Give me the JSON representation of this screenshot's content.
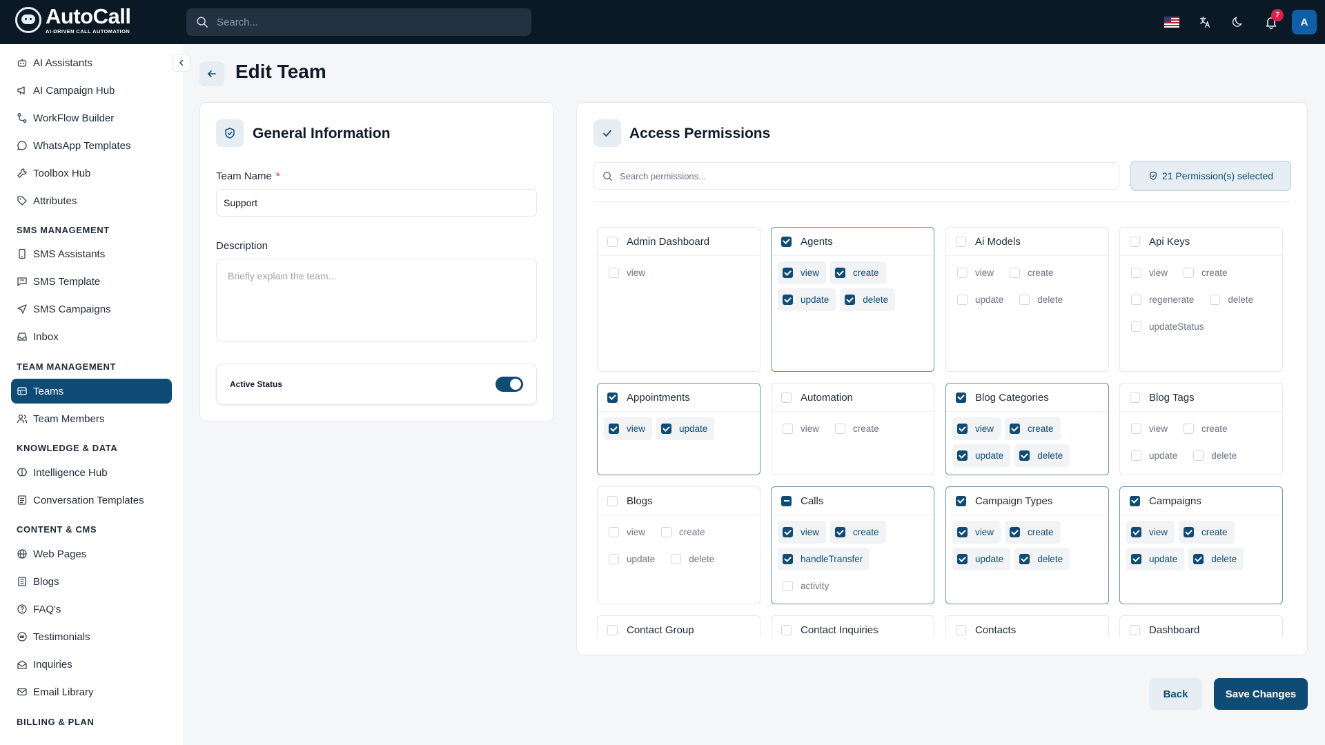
{
  "brand": {
    "name": "AutoCall",
    "tagline": "AI-DRIVEN CALL AUTOMATION"
  },
  "topbar": {
    "search_placeholder": "Search...",
    "notification_count": "7",
    "avatar_initial": "A"
  },
  "sidebar": {
    "items_top": [
      {
        "label": "AI Assistants",
        "icon": "robot-icon"
      },
      {
        "label": "AI Campaign Hub",
        "icon": "megaphone-icon"
      },
      {
        "label": "WorkFlow Builder",
        "icon": "workflow-icon"
      },
      {
        "label": "WhatsApp Templates",
        "icon": "chat-icon"
      },
      {
        "label": "Toolbox Hub",
        "icon": "wrench-icon"
      },
      {
        "label": "Attributes",
        "icon": "tag-icon"
      }
    ],
    "sections": {
      "sms": "SMS MANAGEMENT",
      "team": "TEAM MANAGEMENT",
      "knowledge": "KNOWLEDGE & DATA",
      "content": "CONTENT & CMS",
      "billing": "BILLING & PLAN"
    },
    "sms_items": [
      {
        "label": "SMS Assistants"
      },
      {
        "label": "SMS Template"
      },
      {
        "label": "SMS Campaigns"
      },
      {
        "label": "Inbox"
      }
    ],
    "team_items": [
      {
        "label": "Teams"
      },
      {
        "label": "Team Members"
      }
    ],
    "knowledge_items": [
      {
        "label": "Intelligence Hub"
      },
      {
        "label": "Conversation Templates"
      }
    ],
    "content_items": [
      {
        "label": "Web Pages"
      },
      {
        "label": "Blogs"
      },
      {
        "label": "FAQ's"
      },
      {
        "label": "Testimonials"
      },
      {
        "label": "Inquiries"
      },
      {
        "label": "Email Library"
      }
    ]
  },
  "page": {
    "title": "Edit Team"
  },
  "general": {
    "title": "General Information",
    "team_name_label": "Team Name",
    "required_mark": "*",
    "team_name_value": "Support",
    "description_label": "Description",
    "description_placeholder": "Briefly explain the team...",
    "active_status_label": "Active Status",
    "active": true
  },
  "permissions": {
    "title": "Access Permissions",
    "search_placeholder": "Search permissions...",
    "selected_text": "21 Permission(s) selected",
    "cards": [
      {
        "name": "Admin Dashboard",
        "state": "none",
        "perms": [
          {
            "label": "view",
            "checked": false
          }
        ]
      },
      {
        "name": "Agents",
        "state": "all",
        "perms": [
          {
            "label": "view",
            "checked": true
          },
          {
            "label": "create",
            "checked": true
          },
          {
            "label": "update",
            "checked": true
          },
          {
            "label": "delete",
            "checked": true
          }
        ]
      },
      {
        "name": "Ai Models",
        "state": "none",
        "perms": [
          {
            "label": "view",
            "checked": false
          },
          {
            "label": "create",
            "checked": false
          },
          {
            "label": "update",
            "checked": false
          },
          {
            "label": "delete",
            "checked": false
          }
        ]
      },
      {
        "name": "Api Keys",
        "state": "none",
        "perms": [
          {
            "label": "view",
            "checked": false
          },
          {
            "label": "create",
            "checked": false
          },
          {
            "label": "regenerate",
            "checked": false
          },
          {
            "label": "delete",
            "checked": false
          },
          {
            "label": "updateStatus",
            "checked": false
          }
        ]
      },
      {
        "name": "Appointments",
        "state": "all",
        "perms": [
          {
            "label": "view",
            "checked": true
          },
          {
            "label": "update",
            "checked": true
          }
        ]
      },
      {
        "name": "Automation",
        "state": "none",
        "perms": [
          {
            "label": "view",
            "checked": false
          },
          {
            "label": "create",
            "checked": false
          }
        ]
      },
      {
        "name": "Blog Categories",
        "state": "all",
        "perms": [
          {
            "label": "view",
            "checked": true
          },
          {
            "label": "create",
            "checked": true
          },
          {
            "label": "update",
            "checked": true
          },
          {
            "label": "delete",
            "checked": true
          }
        ]
      },
      {
        "name": "Blog Tags",
        "state": "none",
        "perms": [
          {
            "label": "view",
            "checked": false
          },
          {
            "label": "create",
            "checked": false
          },
          {
            "label": "update",
            "checked": false
          },
          {
            "label": "delete",
            "checked": false
          }
        ]
      },
      {
        "name": "Blogs",
        "state": "none",
        "perms": [
          {
            "label": "view",
            "checked": false
          },
          {
            "label": "create",
            "checked": false
          },
          {
            "label": "update",
            "checked": false
          },
          {
            "label": "delete",
            "checked": false
          }
        ]
      },
      {
        "name": "Calls",
        "state": "partial",
        "perms": [
          {
            "label": "view",
            "checked": true
          },
          {
            "label": "create",
            "checked": true
          },
          {
            "label": "handleTransfer",
            "checked": true
          },
          {
            "label": "activity",
            "checked": false
          }
        ]
      },
      {
        "name": "Campaign Types",
        "state": "all",
        "perms": [
          {
            "label": "view",
            "checked": true
          },
          {
            "label": "create",
            "checked": true
          },
          {
            "label": "update",
            "checked": true
          },
          {
            "label": "delete",
            "checked": true
          }
        ]
      },
      {
        "name": "Campaigns",
        "state": "all",
        "perms": [
          {
            "label": "view",
            "checked": true
          },
          {
            "label": "create",
            "checked": true
          },
          {
            "label": "update",
            "checked": true
          },
          {
            "label": "delete",
            "checked": true
          }
        ]
      },
      {
        "name": "Contact Group",
        "state": "none",
        "perms": []
      },
      {
        "name": "Contact Inquiries",
        "state": "none",
        "perms": []
      },
      {
        "name": "Contacts",
        "state": "none",
        "perms": []
      },
      {
        "name": "Dashboard",
        "state": "none",
        "perms": []
      }
    ]
  },
  "actions": {
    "back": "Back",
    "save": "Save Changes"
  },
  "colors": {
    "primary": "#0f4c75",
    "topbar": "#0b1826",
    "accent_bg": "#e6edf3",
    "badge": "#e11d48"
  }
}
